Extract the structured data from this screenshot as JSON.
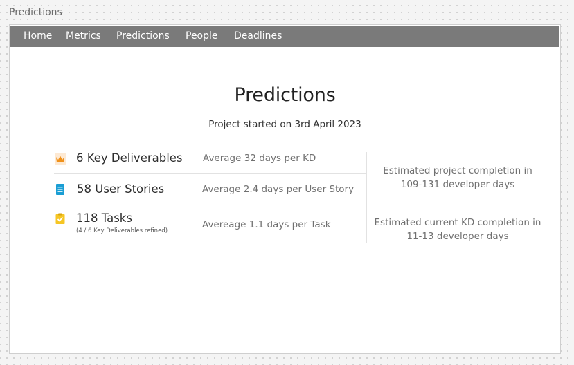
{
  "window": {
    "title": "Predictions"
  },
  "nav": {
    "items": [
      "Home",
      "Metrics",
      "Predictions",
      "People",
      "Deadlines"
    ]
  },
  "page": {
    "title": "Predictions",
    "subtitle": "Project started on 3rd April 2023"
  },
  "metrics": [
    {
      "icon": "crown-icon",
      "label": "6 Key Deliverables",
      "average": "Average 32 days per KD"
    },
    {
      "icon": "document-icon",
      "label": "58 User Stories",
      "average": "Average 2.4 days per User Story"
    },
    {
      "icon": "clipboard-check-icon",
      "label": "118 Tasks",
      "sublabel": "(4 / 6 Key Deliverables refined)",
      "average": "Avereage 1.1 days per Task"
    }
  ],
  "estimates": {
    "project": {
      "line1": "Estimated project completion in",
      "line2": "109-131 developer days"
    },
    "current_kd": {
      "line1": "Estimated current KD completion in",
      "line2": "11-13 developer days"
    }
  },
  "colors": {
    "navbar": "#7a7a7a",
    "crown_icon": "#f0921c",
    "document_icon": "#1a9ed4",
    "clipboard_icon": "#f6c624"
  }
}
